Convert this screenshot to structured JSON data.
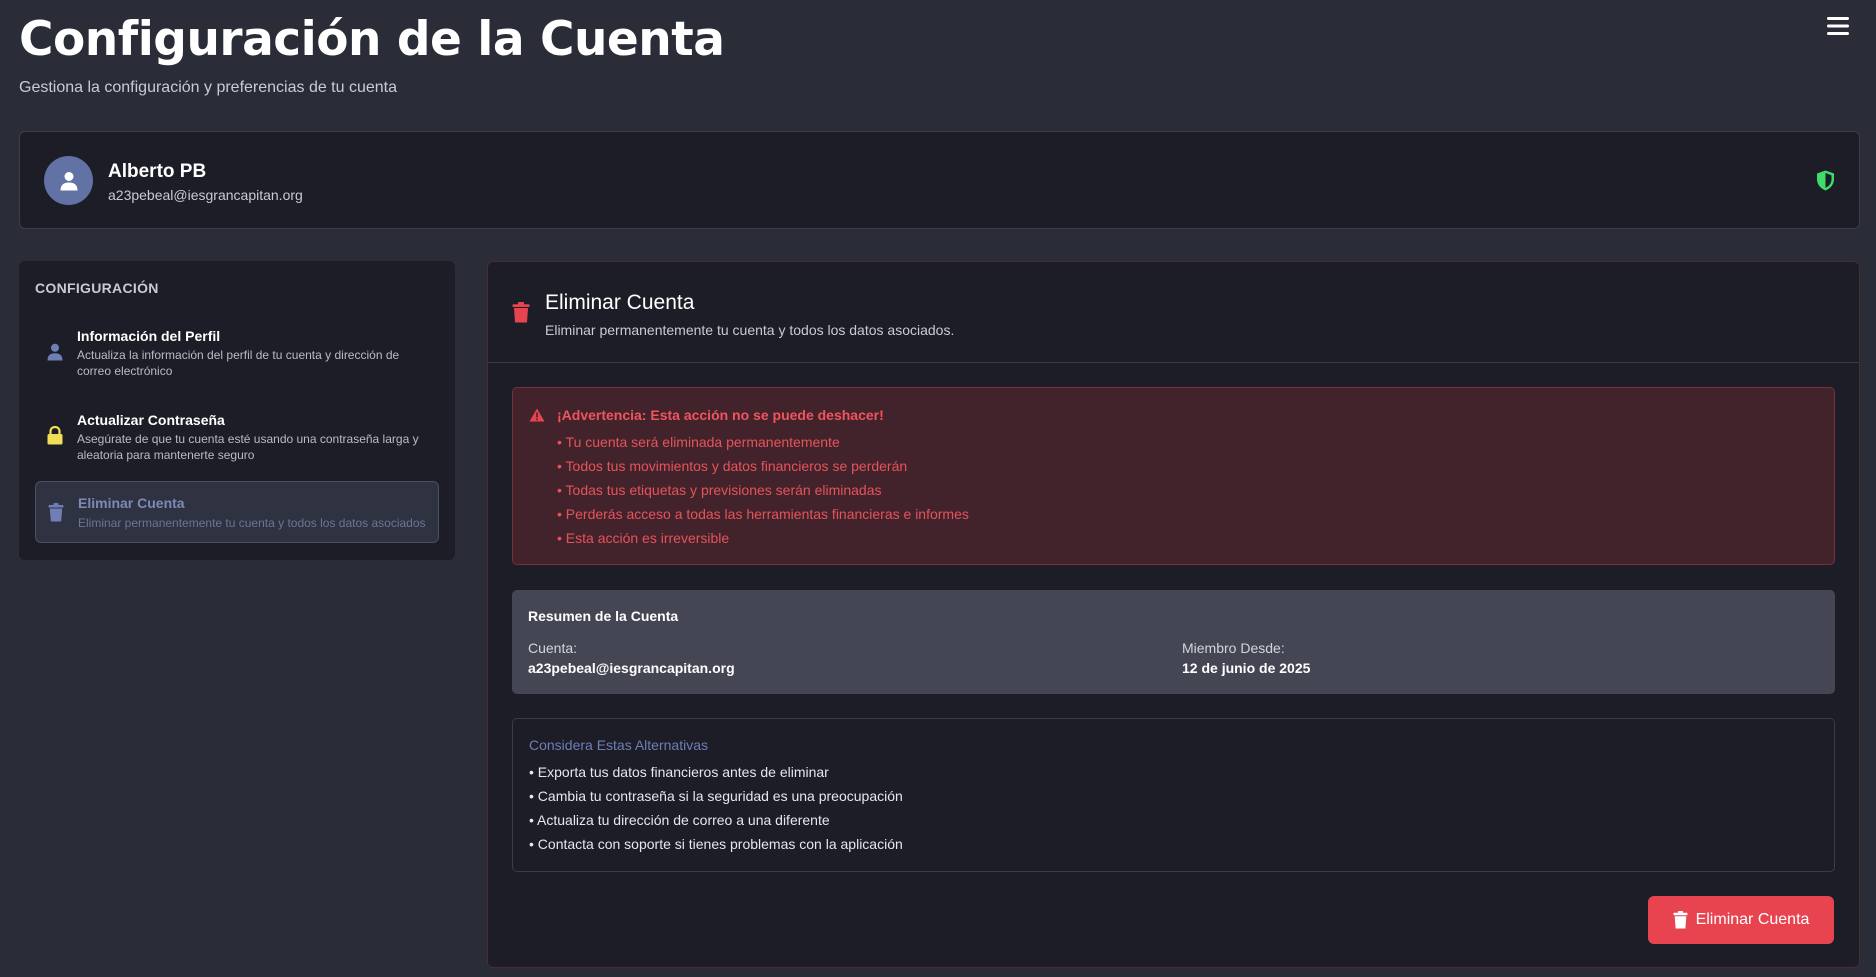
{
  "header": {
    "title": "Configuración de la Cuenta",
    "subtitle": "Gestiona la configuración y preferencias de tu cuenta"
  },
  "profile": {
    "name": "Alberto PB",
    "email": "a23pebeal@iesgrancapitan.org"
  },
  "sidebar": {
    "heading": "CONFIGURACIÓN",
    "items": [
      {
        "label": "Información del Perfil",
        "description": "Actualiza la información del perfil de tu cuenta y dirección de correo electrónico",
        "icon": "user-icon"
      },
      {
        "label": "Actualizar Contraseña",
        "description": "Asegúrate de que tu cuenta esté usando una contraseña larga y aleatoria para mantenerte seguro",
        "icon": "lock-icon"
      },
      {
        "label": "Eliminar Cuenta",
        "description": "Eliminar permanentemente tu cuenta y todos los datos asociados",
        "icon": "trash-icon"
      }
    ]
  },
  "main": {
    "title": "Eliminar Cuenta",
    "description": "Eliminar permanentemente tu cuenta y todos los datos asociados.",
    "warning": {
      "title": "¡Advertencia: Esta acción no se puede deshacer!",
      "items": [
        "• Tu cuenta será eliminada permanentemente",
        "• Todos tus movimientos y datos financieros se perderán",
        "• Todas tus etiquetas y previsiones serán eliminadas",
        "• Perderás acceso a todas las herramientas financieras e informes",
        "• Esta acción es irreversible"
      ]
    },
    "summary": {
      "title": "Resumen de la Cuenta",
      "account_label": "Cuenta:",
      "account_value": "a23pebeal@iesgrancapitan.org",
      "member_label": "Miembro Desde:",
      "member_value": "12 de junio de 2025"
    },
    "alternatives": {
      "title": "Considera Estas Alternativas",
      "items": [
        "• Exporta tus datos financieros antes de eliminar",
        "• Cambia tu contraseña si la seguridad es una preocupación",
        "• Actualiza tu dirección de correo a una diferente",
        "• Contacta con soporte si tienes problemas con la aplicación"
      ]
    },
    "delete_button_label": "Eliminar Cuenta"
  },
  "colors": {
    "background": "#2a2c38",
    "card": "#1c1d26",
    "accent": "#6272a4",
    "danger": "#e74450",
    "success": "#3ddc6b"
  }
}
